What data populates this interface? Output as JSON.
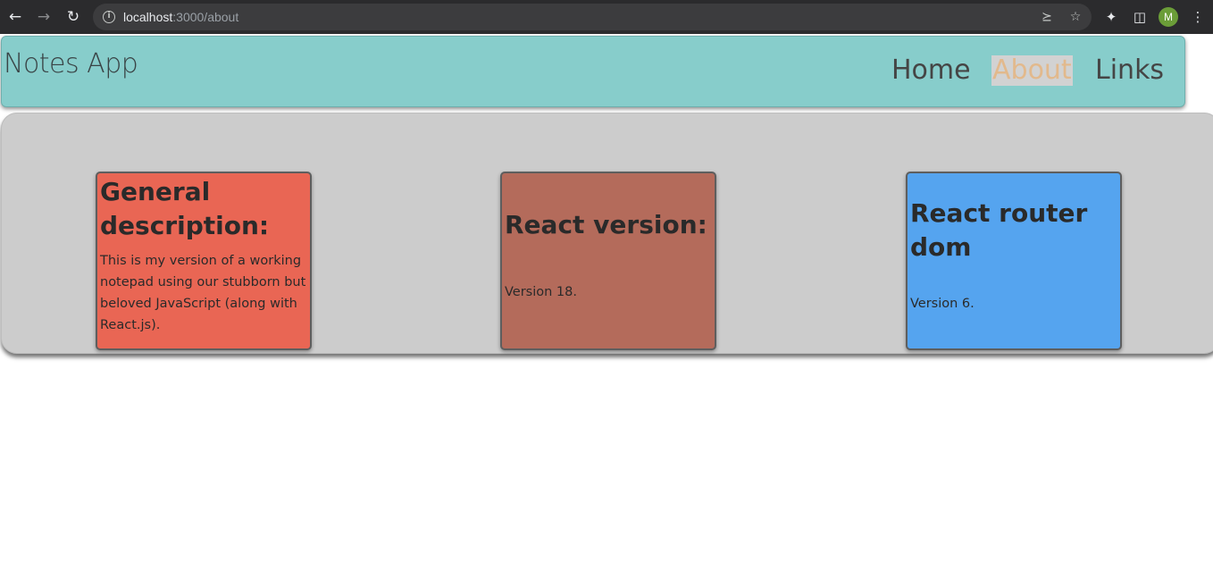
{
  "browser": {
    "url_host": "localhost",
    "url_path": ":3000/about",
    "avatar_letter": "M",
    "icons": [
      "back-icon",
      "forward-icon",
      "reload-icon",
      "info-icon",
      "share-icon",
      "star-icon",
      "extensions-icon",
      "side-panel-icon",
      "menu-icon"
    ]
  },
  "header": {
    "title": "Notes App",
    "nav": {
      "home": "Home",
      "about": "About",
      "links": "Links"
    },
    "background": "#87cdcb",
    "active_link_color": "#e2b98c"
  },
  "cards": [
    {
      "title": "General description:",
      "text": "This is my version of a working notepad using our stubborn but beloved JavaScript (along with React.js).",
      "color": "#e96654"
    },
    {
      "title": "React version:",
      "text": "Version 18.",
      "color": "#b46b5b"
    },
    {
      "title": "React router dom",
      "text": "Version 6.",
      "color": "#55a4ef"
    }
  ]
}
